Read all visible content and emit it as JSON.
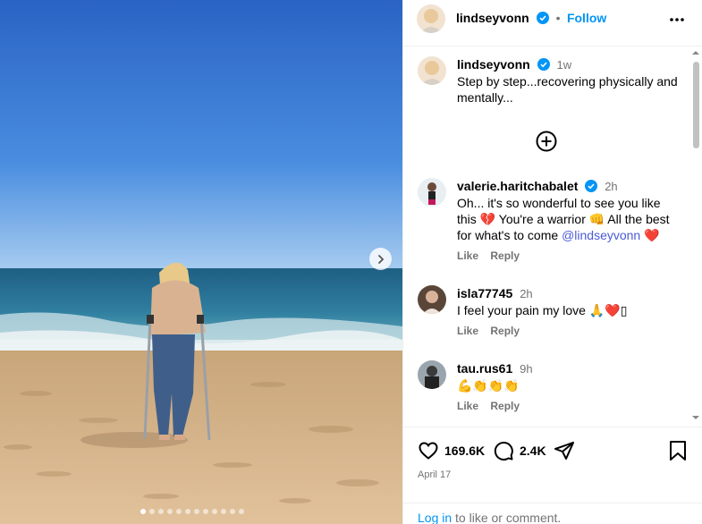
{
  "post": {
    "author": "lindseyvonn",
    "follow_label": "Follow",
    "separator": "•",
    "more_icon": "more-horizontal-icon",
    "caption_author": "lindseyvonn",
    "caption_time": "1w",
    "caption_text": "Step by step...recovering physically and mentally..."
  },
  "comments": [
    {
      "user": "valerie.haritchabalet",
      "time": "2h",
      "text_parts": [
        "Oh... it's so wonderful to see you like this ",
        "💔",
        " You're a warrior ",
        "👊",
        " All the best for what's to come "
      ],
      "mention": "@lindseyvonn",
      "tail_emoji": "❤️",
      "like": "Like",
      "reply": "Reply"
    },
    {
      "user": "isla77745",
      "time": "2h",
      "text": "I feel your pain my love 🙏❤️▯",
      "like": "Like",
      "reply": "Reply"
    },
    {
      "user": "tau.rus61",
      "time": "9h",
      "text": "💪👏👏👏",
      "like": "Like",
      "reply": "Reply"
    }
  ],
  "stats": {
    "likes": "169.6K",
    "comments": "2.4K",
    "date": "April 17"
  },
  "login": {
    "link": "Log in",
    "rest": " to like or comment."
  },
  "carousel": {
    "count": 12,
    "active": 0
  },
  "colors": {
    "accent": "#0095f6",
    "muted": "#737373",
    "heart": "#ed4956",
    "sky": "#3b7bd6",
    "sea": "#2c6f8f",
    "sand": "#d9b68a"
  }
}
